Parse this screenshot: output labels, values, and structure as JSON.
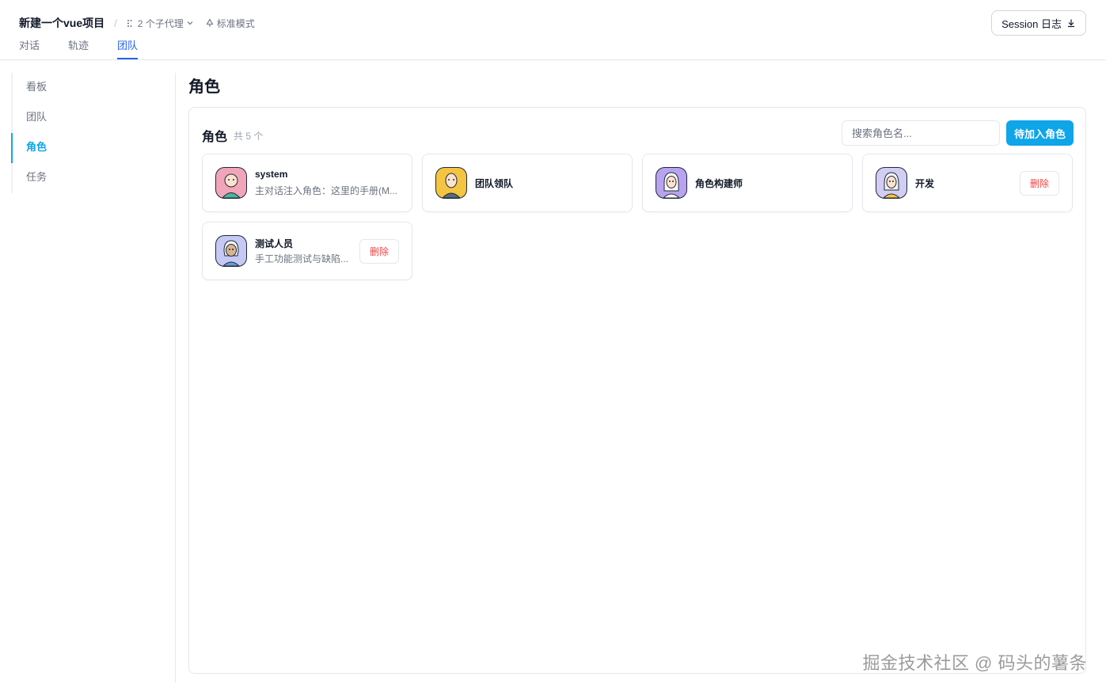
{
  "header": {
    "project_title": "新建一个vue项目",
    "separator": "/",
    "subagents": "2 个子代理",
    "mode": "标准模式",
    "session_button": "Session 日志",
    "tabs": [
      {
        "label": "对话",
        "active": false
      },
      {
        "label": "轨迹",
        "active": false
      },
      {
        "label": "团队",
        "active": true
      }
    ]
  },
  "sidebar": {
    "items": [
      {
        "label": "看板",
        "active": false
      },
      {
        "label": "团队",
        "active": false
      },
      {
        "label": "角色",
        "active": true
      },
      {
        "label": "任务",
        "active": false
      }
    ]
  },
  "main": {
    "page_title": "角色",
    "panel": {
      "title": "角色",
      "count": "共 5 个",
      "search_placeholder": "搜索角色名...",
      "add_button": "待加入角色",
      "roles": [
        {
          "name": "system",
          "desc": "主对话注入角色：这里的手册(M...",
          "avatar_color": "#f0a6b8",
          "has_delete": false
        },
        {
          "name": "团队领队",
          "desc": "",
          "avatar_color": "#f5c542",
          "has_delete": false
        },
        {
          "name": "角色构建师",
          "desc": "",
          "avatar_color": "#b9a3f0",
          "has_delete": false
        },
        {
          "name": "开发",
          "desc": "",
          "avatar_color": "#d2cdf3",
          "has_delete": true,
          "delete_label": "删除"
        },
        {
          "name": "测试人员",
          "desc": "手工功能测试与缺陷...",
          "avatar_color": "#c5c9f4",
          "has_delete": true,
          "delete_label": "删除"
        }
      ]
    }
  },
  "watermark": "掘金技术社区 @ 码头的薯条",
  "colors": {
    "accent": "#0ea5e9",
    "tab_active": "#2563eb",
    "danger": "#ef4444"
  }
}
